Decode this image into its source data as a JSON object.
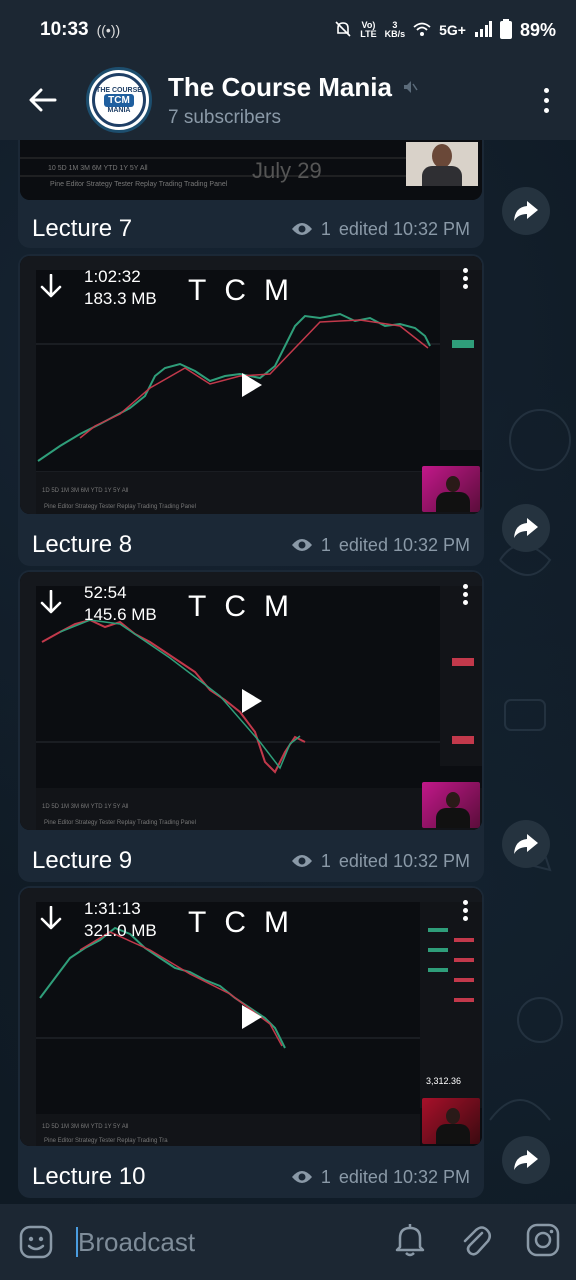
{
  "status_bar": {
    "time": "10:33",
    "network_top": "Vo)",
    "network_bottom": "LTE",
    "speed_top": "3",
    "speed_bottom": "KB/s",
    "signal": "5G+",
    "battery": "89%"
  },
  "header": {
    "title": "The Course Mania",
    "subtitle": "7 subscribers",
    "avatar_top": "THE COURSE",
    "avatar_mid": "TCM",
    "avatar_bot": "MANIA"
  },
  "partial_message": {
    "caption": "Lecture 7",
    "views": "1",
    "edited": "edited 10:32 PM",
    "watermark": "July 29"
  },
  "messages": [
    {
      "duration": "1:02:32",
      "size": "183.3 MB",
      "watermark": "TCM",
      "caption": "Lecture 8",
      "views": "1",
      "edited": "edited 10:32 PM"
    },
    {
      "duration": "52:54",
      "size": "145.6 MB",
      "watermark": "TCM",
      "caption": "Lecture 9",
      "views": "1",
      "edited": "edited 10:32 PM"
    },
    {
      "duration": "1:31:13",
      "size": "321.0 MB",
      "watermark": "TCM",
      "caption": "Lecture 10",
      "views": "1",
      "edited": "edited 10:32 PM"
    }
  ],
  "composer": {
    "placeholder": "Broadcast"
  },
  "icons": {
    "back": "arrow-left-icon",
    "menu": "more-vertical-icon",
    "mute": "mute-icon",
    "download": "download-icon",
    "play": "play-icon",
    "share": "share-icon",
    "eye": "eye-icon",
    "emoji": "emoji-icon",
    "bell": "bell-icon",
    "attach": "paperclip-icon",
    "camera": "instagram-camera-icon"
  }
}
